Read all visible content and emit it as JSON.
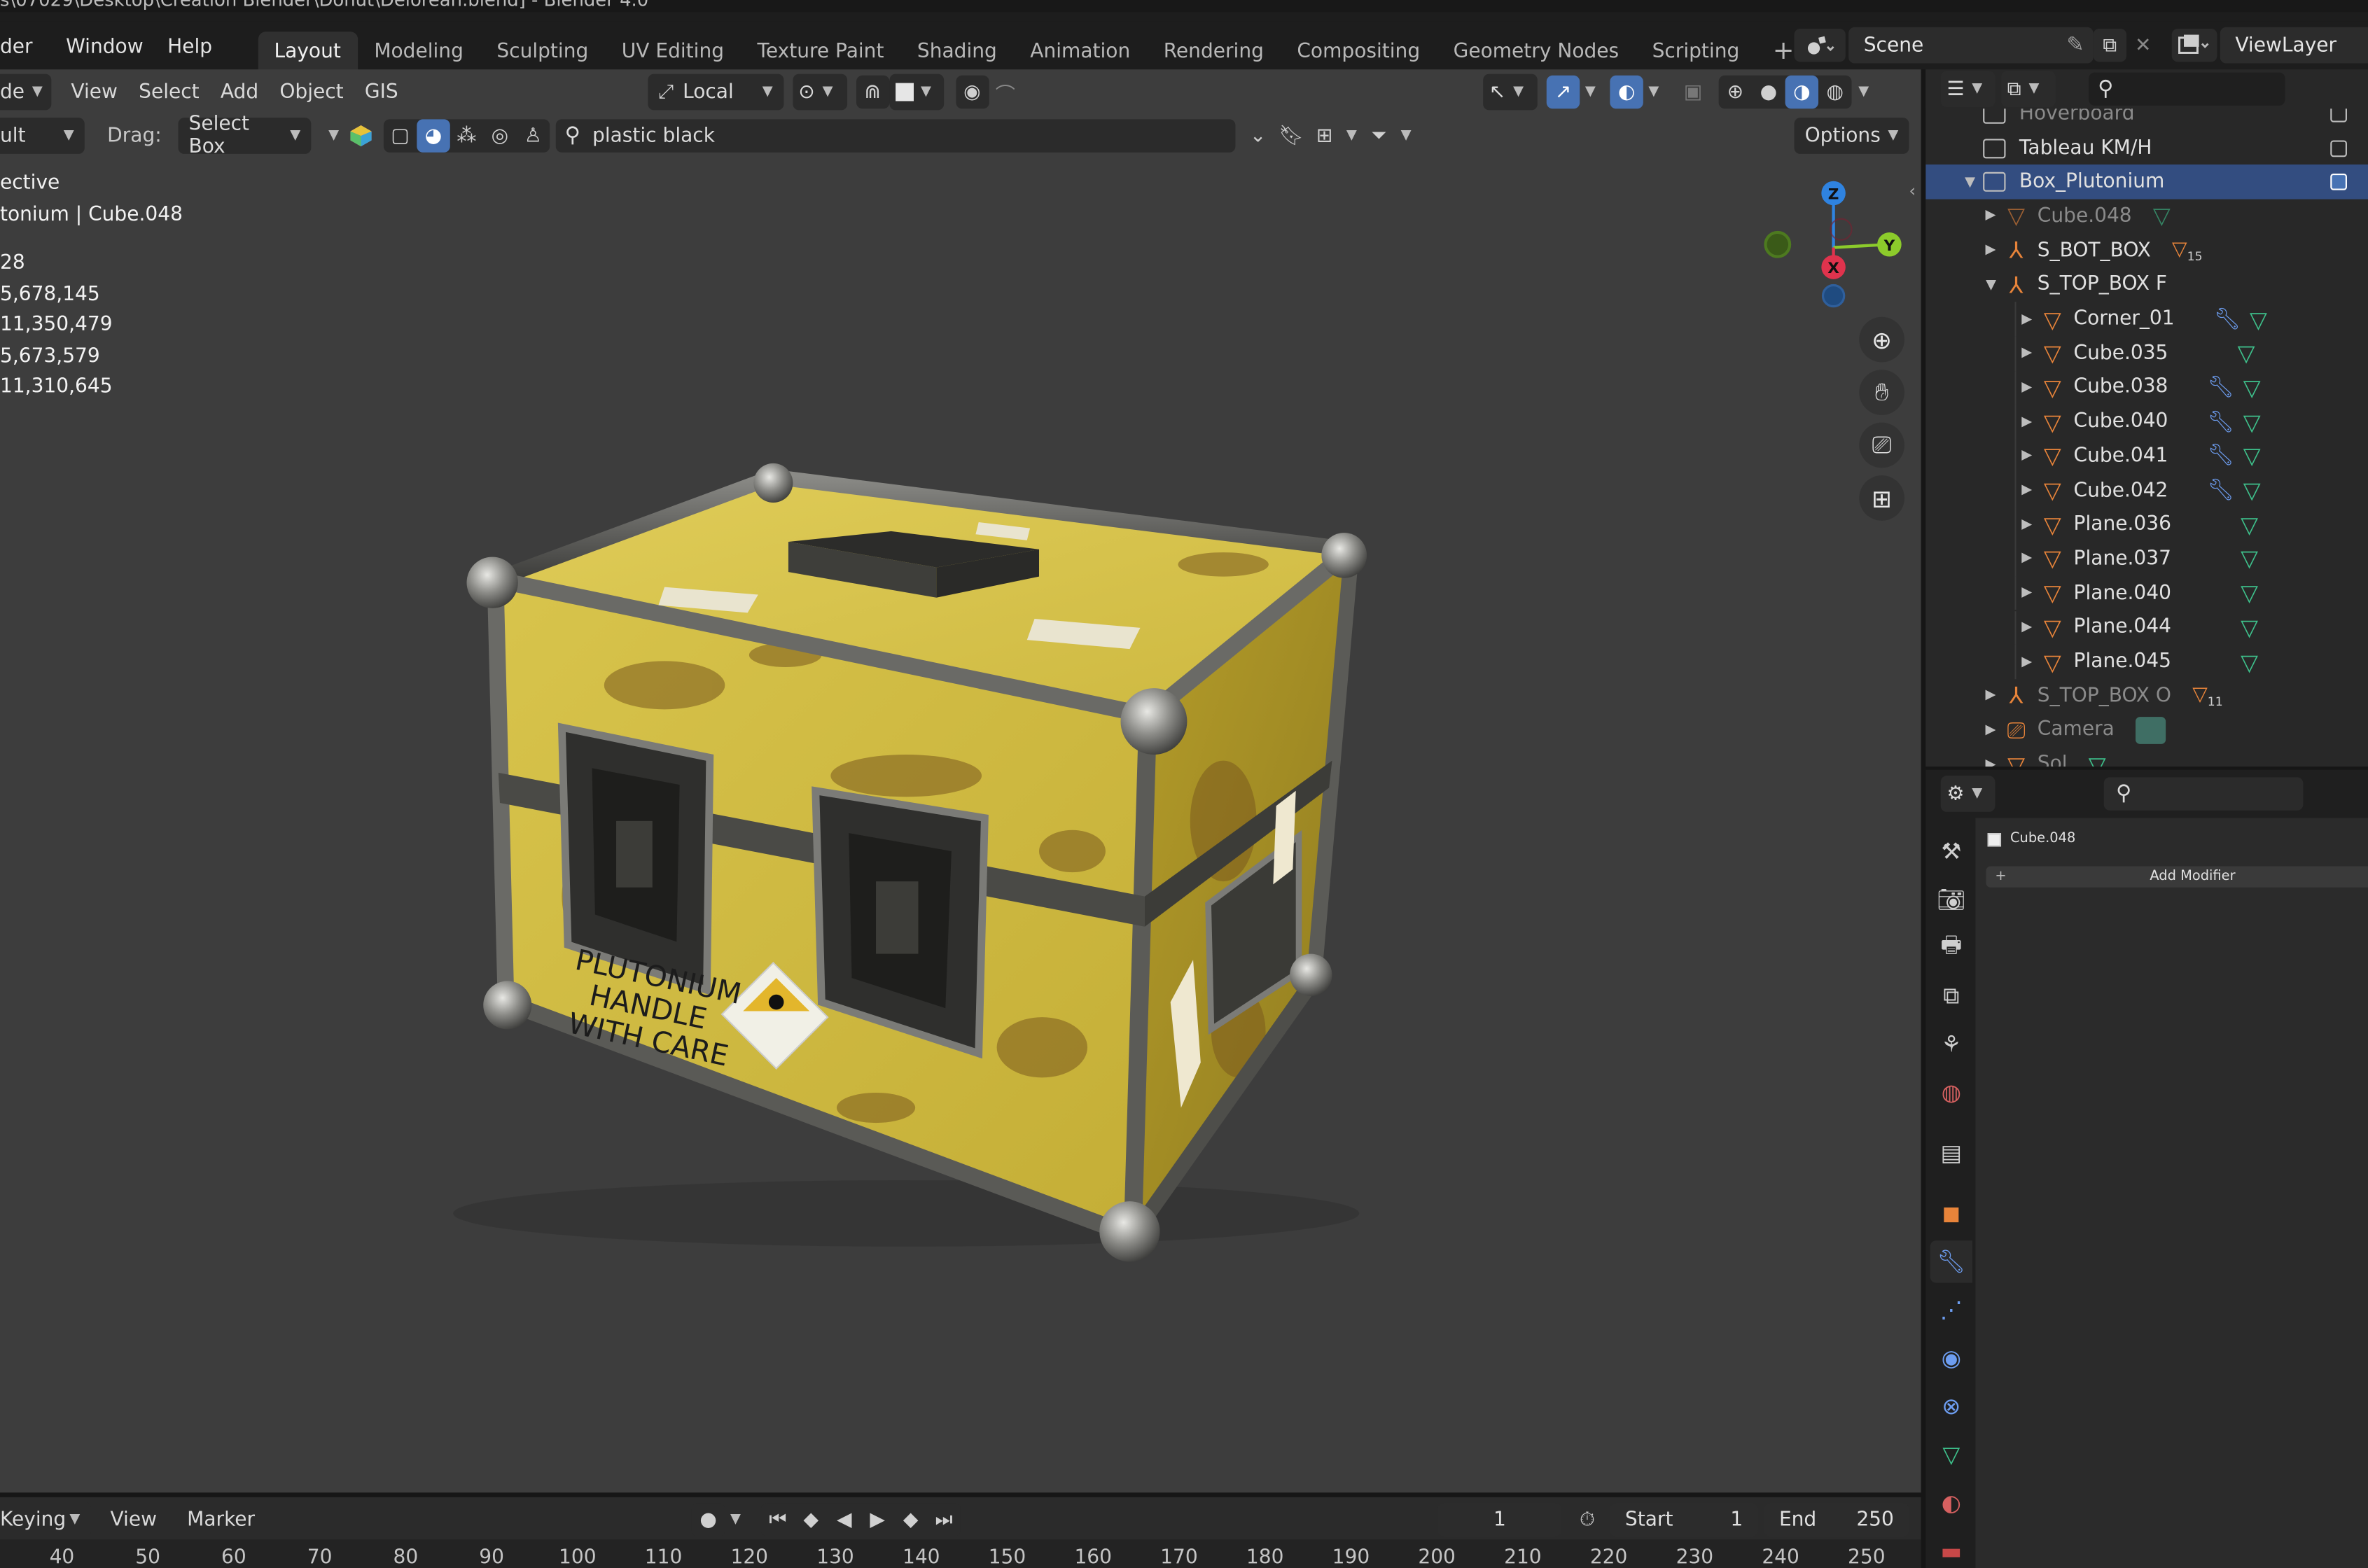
{
  "titlebar": {
    "text": "s\\07029\\Desktop\\Creation Blender\\Donut\\Delorean.blend] - Blender 4.0"
  },
  "menu": {
    "items": [
      "der",
      "Window",
      "Help"
    ]
  },
  "workspaces": [
    "Layout",
    "Modeling",
    "Sculpting",
    "UV Editing",
    "Texture Paint",
    "Shading",
    "Animation",
    "Rendering",
    "Compositing",
    "Geometry Nodes",
    "Scripting"
  ],
  "workspace_add": "+",
  "scene": {
    "label": "Scene",
    "viewlayer": "ViewLayer"
  },
  "viewport_header": {
    "mode": "de",
    "menus": [
      "View",
      "Select",
      "Add",
      "Object",
      "GIS"
    ],
    "transform_orientation": "Local",
    "orientation_label": "ult",
    "drag_label": "Drag:",
    "drag_value": "Select Box",
    "search_value": "plastic black",
    "options_label": "Options"
  },
  "overlay_text": {
    "view_name": "ective",
    "object_path": "tonium | Cube.048",
    "stats": [
      "28",
      "5,678,145",
      "11,350,479",
      "5,673,579",
      "11,310,645"
    ]
  },
  "box_labels": {
    "line1": "PLUTONIUM",
    "line2": "HANDLE",
    "line3": "WITH CARE"
  },
  "gizmo": {
    "z": "Z",
    "y": "Y",
    "x": "X"
  },
  "timeline": {
    "keying": "Keying",
    "view": "View",
    "marker": "Marker",
    "current_frame": "1",
    "start_label": "Start",
    "start_value": "1",
    "end_label": "End",
    "end_value": "250",
    "ticks": [
      "40",
      "50",
      "60",
      "70",
      "80",
      "90",
      "100",
      "110",
      "120",
      "130",
      "140",
      "150",
      "160",
      "170",
      "180",
      "190",
      "200",
      "210",
      "220",
      "230",
      "240",
      "250"
    ]
  },
  "outliner": {
    "rows": [
      {
        "name": "Hoverboard",
        "kind": "collection-partial"
      },
      {
        "name": "Tableau KM/H",
        "kind": "collection"
      },
      {
        "name": "Box_Plutonium",
        "kind": "collection-selected"
      },
      {
        "name": "Cube.048",
        "kind": "mesh-dim"
      },
      {
        "name": "S_BOT_BOX",
        "kind": "empty",
        "badge": "15"
      },
      {
        "name": "S_TOP_BOX F",
        "kind": "empty-open"
      },
      {
        "name": "Corner_01",
        "kind": "child-mod"
      },
      {
        "name": "Cube.035",
        "kind": "child"
      },
      {
        "name": "Cube.038",
        "kind": "child-mod"
      },
      {
        "name": "Cube.040",
        "kind": "child-mod"
      },
      {
        "name": "Cube.041",
        "kind": "child-mod"
      },
      {
        "name": "Cube.042",
        "kind": "child-mod"
      },
      {
        "name": "Plane.036",
        "kind": "child"
      },
      {
        "name": "Plane.037",
        "kind": "child"
      },
      {
        "name": "Plane.040",
        "kind": "child"
      },
      {
        "name": "Plane.044",
        "kind": "child"
      },
      {
        "name": "Plane.045",
        "kind": "child"
      },
      {
        "name": "S_TOP_BOX O",
        "kind": "empty-dim",
        "badge": "11"
      },
      {
        "name": "Camera",
        "kind": "camera"
      },
      {
        "name": "Sol",
        "kind": "mesh-partial"
      }
    ]
  },
  "properties": {
    "object_name": "Cube.048",
    "add_modifier": "Add Modifier",
    "add_icon": "+"
  },
  "colors": {
    "accent": "#4772b3",
    "selected_row": "#334d80",
    "viewport_bg": "#3d3d3d",
    "box_yellow": "#d8c24a",
    "axis_x": "#e0334d",
    "axis_y": "#8ccb2b",
    "axis_z": "#2f83e0"
  }
}
